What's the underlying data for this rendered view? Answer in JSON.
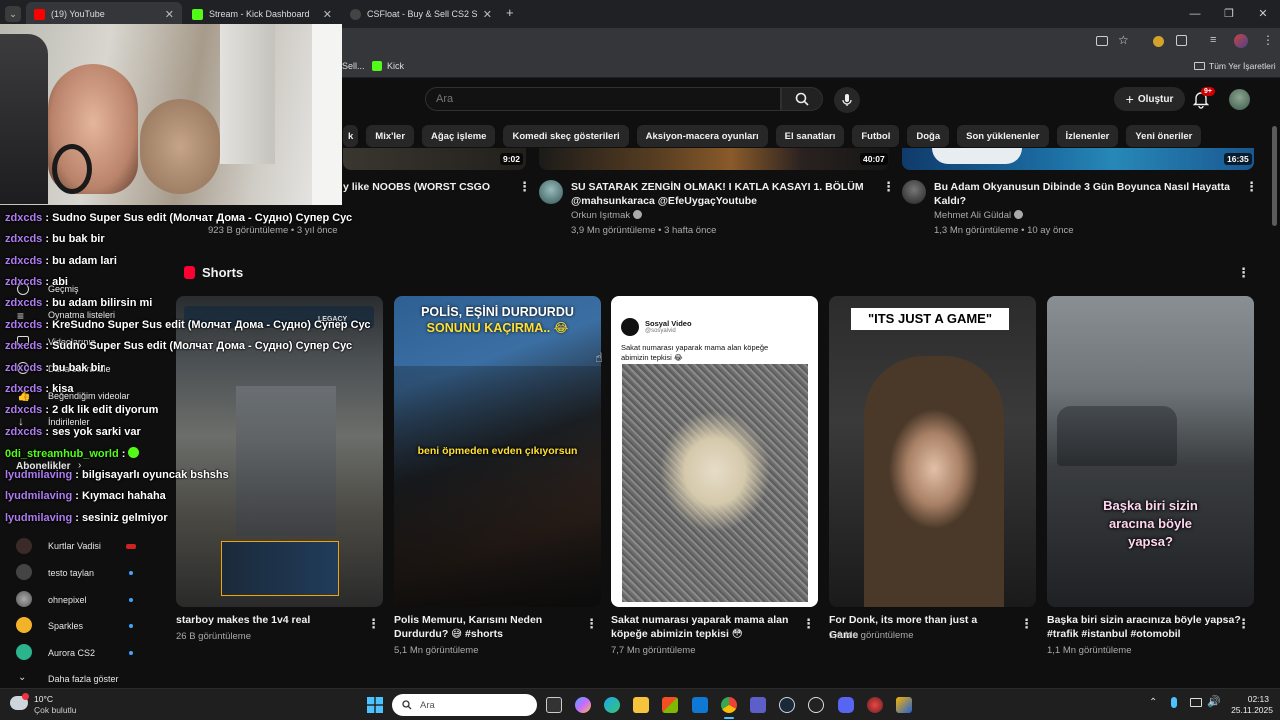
{
  "browser": {
    "tabs": [
      {
        "label": "(19) YouTube",
        "close": "✕"
      },
      {
        "label": "Stream - Kick Dashboard",
        "close": "✕"
      },
      {
        "label": "CSFloat - Buy & Sell CS2 Skins",
        "close": "✕"
      }
    ],
    "new_tab": "+",
    "bookmarks": [
      "Sell...",
      "Kick"
    ],
    "all_bookmarks": "Tüm Yer İşaretleri"
  },
  "youtube": {
    "search_placeholder": "Ara",
    "create_label": "Oluştur",
    "notif_badge": "9+",
    "chips": [
      "k",
      "Mix'ler",
      "Ağaç işleme",
      "Komedi skeç gösterileri",
      "Aksiyon-macera oyunları",
      "El sanatları",
      "Futbol",
      "Doğa",
      "Son yüklenenler",
      "İzlenenler",
      "Yeni öneriler"
    ],
    "videos": [
      {
        "duration": "9:02",
        "title1": "y like NOOBS (WORST CSGO",
        "title2": "",
        "channel": "",
        "meta": "923 B görüntüleme • 3 yıl önce"
      },
      {
        "duration": "40:07",
        "title1": "SU SATARAK ZENGİN OLMAK! I KATLA KASAYI 1. BÖLÜM",
        "title2": "@mahsunkaraca @EfeUygaçYoutube",
        "channel": "Orkun Işıtmak",
        "meta": "3,9 Mn görüntüleme • 3 hafta önce"
      },
      {
        "duration": "16:35",
        "title1": "Bu Adam Okyanusun Dibinde 3 Gün Boyunca Nasıl Hayatta",
        "title2": "Kaldı?",
        "channel": "Mehmet Ali Güldal",
        "meta": "1,3 Mn görüntüleme • 10 ay önce"
      }
    ],
    "shorts_heading": "Shorts",
    "shorts": [
      {
        "title1": "starboy makes the 1v4 real",
        "title2": "",
        "views": "26 B görüntüleme",
        "overlay": [
          "LEGACY"
        ]
      },
      {
        "title1": "Polis Memuru, Karısını Neden",
        "title2": "Durdurdu? 😅 #shorts",
        "views": "5,1 Mn görüntüleme",
        "overlay": [
          "POLİS, EŞİNİ DURDURDU",
          "SONUNU KAÇIRMA.. 😂",
          "beni öpmeden evden çıkıyorsun"
        ]
      },
      {
        "title1": "Sakat numarası yaparak mama alan",
        "title2": "köpeğe abimizin tepkisi 😳",
        "views": "7,7 Mn görüntüleme",
        "overlay": [
          "Sosyal Video",
          "@sosyalvid",
          "Sakat numarası yaparak mama alan köpeğe",
          "abimizin tepkisi 😂"
        ]
      },
      {
        "title1": "For Donk, its more than just a Game",
        "title2": "",
        "views": "1,6 Mn görüntüleme",
        "overlay": [
          "\"ITS JUST A GAME\""
        ]
      },
      {
        "title1": "Başka biri sizin aracınıza böyle yapsa?",
        "title2": "#trafik #istanbul #otomobil",
        "views": "1,1 Mn görüntüleme",
        "overlay": [
          "Başka biri sizin",
          "aracına böyle",
          "yapsa?"
        ]
      }
    ]
  },
  "sidebar": {
    "items": [
      "Geçmiş",
      "Oynatma listeleri",
      "Videolarınız",
      "Daha sonra izle",
      "Beğendiğim videolar",
      "İndirilenler"
    ],
    "subs_heading": "Abonelikler",
    "channels": [
      "Kurtlar Vadisi",
      "testo taylan",
      "ohnepixel",
      "Sparkles",
      "Aurora CS2"
    ],
    "more": "Daha fazla göster"
  },
  "chat": [
    {
      "user": "zdxcds",
      "msg": " : Sudno Super Sus edit (Молчат Дома - Судно) Супер Сус"
    },
    {
      "user": "zdxcds",
      "msg": " : bu bak bir"
    },
    {
      "user": "zdxcds",
      "msg": " : bu adam lari"
    },
    {
      "user": "zdxcds",
      "msg": " : abi"
    },
    {
      "user": "zdxcds",
      "msg": " : bu adam bilirsin mi"
    },
    {
      "user": "zdxcds",
      "msg": " : KreSudno Super Sus edit (Молчат Дома - Судно) Супер Сус"
    },
    {
      "user": "zdxcds",
      "msg": " : Sudno Super Sus edit (Молчат Дома - Судно) Супер Сус"
    },
    {
      "user": "zdxcds",
      "msg": " : bu bak bir"
    },
    {
      "user": "zdxcds",
      "msg": " : kisa"
    },
    {
      "user": "zdxcds",
      "msg": " : 2 dk lik edit diyorum"
    },
    {
      "user": "zdxcds",
      "msg": " : ses yok sarki var"
    },
    {
      "user": "0di_streamhub_world",
      "msg": " : "
    },
    {
      "user": "lyudmilaving",
      "msg": " : bilgisayarlı oyuncak bshshs"
    },
    {
      "user": "lyudmilaving",
      "msg": " : Kıymacı hahaha"
    },
    {
      "user": "lyudmilaving",
      "msg": " : sesiniz gelmiyor"
    }
  ],
  "taskbar": {
    "temp": "10°C",
    "weather": "Çok bulutlu",
    "search": "Ara",
    "time": "02:13",
    "date": "25.11.2025"
  }
}
